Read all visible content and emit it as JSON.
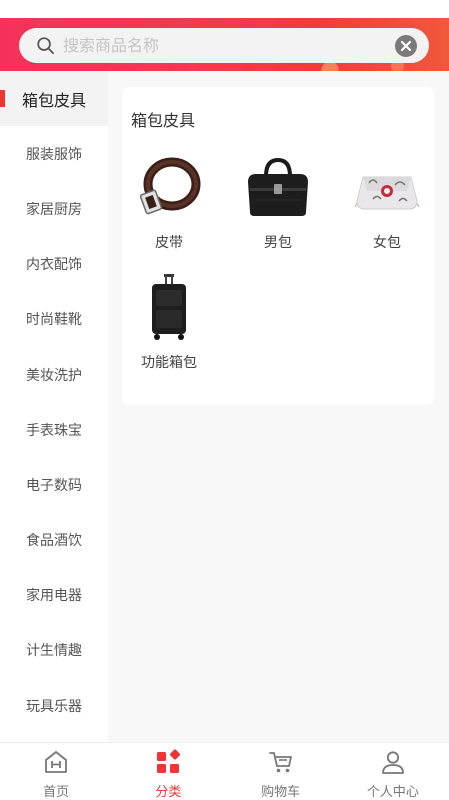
{
  "search": {
    "placeholder": "搜索商品名称",
    "value": ""
  },
  "sidebar": {
    "items": [
      {
        "label": "箱包皮具",
        "active": true
      },
      {
        "label": "服装服饰"
      },
      {
        "label": "家居厨房"
      },
      {
        "label": "内衣配饰"
      },
      {
        "label": "时尚鞋靴"
      },
      {
        "label": "美妆洗护"
      },
      {
        "label": "手表珠宝"
      },
      {
        "label": "电子数码"
      },
      {
        "label": "食品酒饮"
      },
      {
        "label": "家用电器"
      },
      {
        "label": "计生情趣"
      },
      {
        "label": "玩具乐器"
      }
    ]
  },
  "category": {
    "title": "箱包皮具",
    "products": [
      {
        "label": "皮带",
        "icon": "belt-image"
      },
      {
        "label": "男包",
        "icon": "mens-bag-image"
      },
      {
        "label": "女包",
        "icon": "womens-bag-image"
      },
      {
        "label": "功能箱包",
        "icon": "luggage-image"
      }
    ]
  },
  "tabbar": {
    "tabs": [
      {
        "label": "首页",
        "icon": "home-icon"
      },
      {
        "label": "分类",
        "icon": "category-icon",
        "active": true
      },
      {
        "label": "购物车",
        "icon": "cart-icon"
      },
      {
        "label": "个人中心",
        "icon": "user-icon"
      }
    ]
  },
  "colors": {
    "accent": "#ee3534",
    "header": "#f23a4f"
  }
}
